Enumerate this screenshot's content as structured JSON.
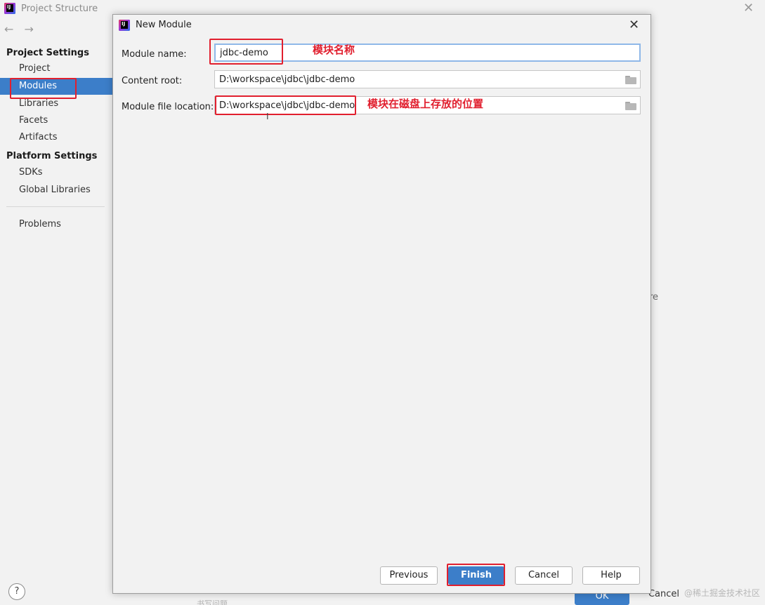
{
  "background_window": {
    "title": "Project Structure",
    "nav_back": "←",
    "nav_forward": "→",
    "sidebar": {
      "project_settings_header": "Project Settings",
      "project_items": [
        "Project",
        "Modules",
        "Libraries",
        "Facets",
        "Artifacts"
      ],
      "platform_settings_header": "Platform Settings",
      "platform_items": [
        "SDKs",
        "Global Libraries"
      ],
      "problems": "Problems",
      "selected": "Modules"
    },
    "help_label": "?",
    "right_fragment": "re",
    "ok_label": "OK",
    "cancel_label": "Cancel",
    "watermark": "@稀土掘金技术社区",
    "bottom_fragment": "书写问题"
  },
  "dialog": {
    "title": "New Module",
    "close_label": "✕",
    "fields": {
      "module_name": {
        "label": "Module name:",
        "value": "jdbc-demo"
      },
      "content_root": {
        "label": "Content root:",
        "value": "D:\\workspace\\jdbc\\jdbc-demo"
      },
      "module_file_location": {
        "label": "Module file location:",
        "value": "D:\\workspace\\jdbc\\jdbc-demo"
      }
    },
    "annotations": {
      "module_name_note": "模块名称",
      "location_note": "模块在磁盘上存放的位置"
    },
    "buttons": {
      "previous": "Previous",
      "finish": "Finish",
      "cancel": "Cancel",
      "help": "Help"
    }
  },
  "colors": {
    "accent": "#3c7ec9",
    "annotation_red": "#e11f2e",
    "window_bg": "#f2f2f2"
  },
  "icons": {
    "app_logo": "intellij-idea-icon",
    "folder": "folder-icon",
    "text_cursor": "text-cursor-icon"
  }
}
